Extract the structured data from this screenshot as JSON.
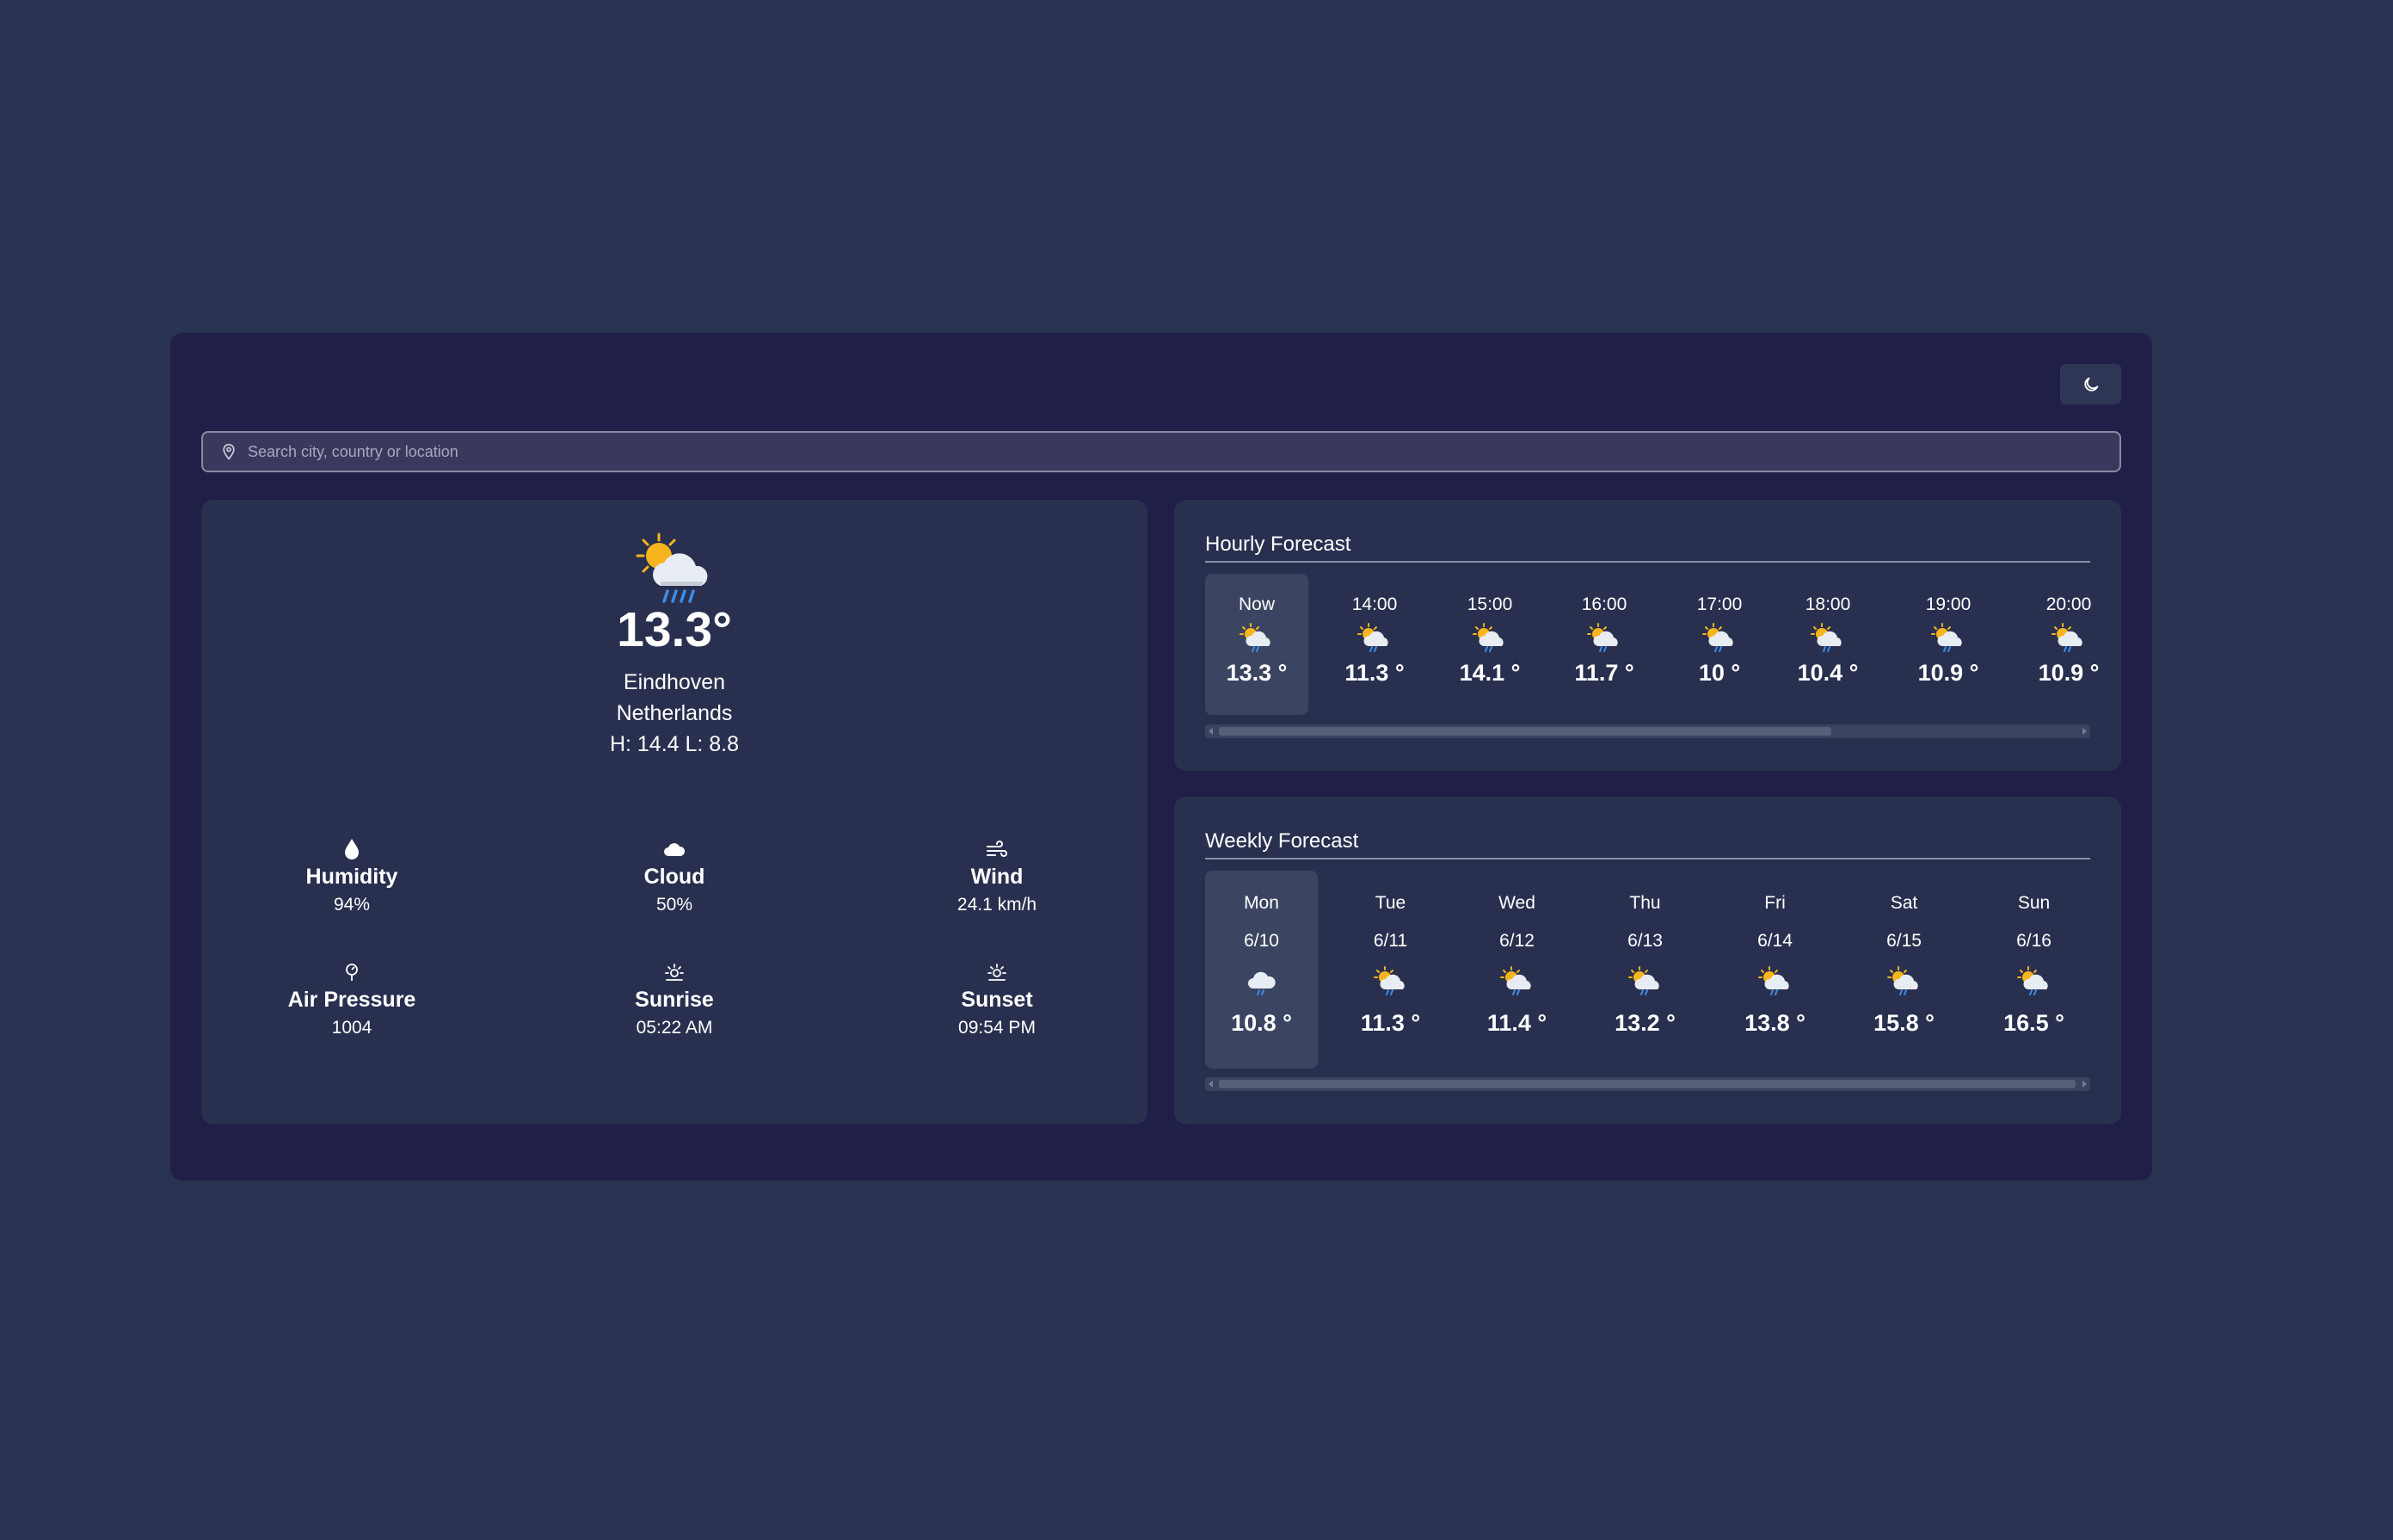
{
  "search": {
    "placeholder": "Search city, country or location"
  },
  "theme_toggle": {
    "icon": "moon-icon"
  },
  "current": {
    "icon": "partly-cloudy-rain-icon",
    "temp": "13.3°",
    "city": "Eindhoven",
    "country": "Netherlands",
    "high_low": "H: 14.4 L: 8.8",
    "stats": [
      {
        "label": "Humidity",
        "value": "94%",
        "icon": "droplet-icon"
      },
      {
        "label": "Cloud",
        "value": "50%",
        "icon": "cloud-icon"
      },
      {
        "label": "Wind",
        "value": "24.1 km/h",
        "icon": "wind-icon"
      },
      {
        "label": "Air Pressure",
        "value": "1004",
        "icon": "pressure-icon"
      },
      {
        "label": "Sunrise",
        "value": "05:22 AM",
        "icon": "sunrise-icon"
      },
      {
        "label": "Sunset",
        "value": "09:54 PM",
        "icon": "sunset-icon"
      }
    ]
  },
  "hourly": {
    "title": "Hourly Forecast",
    "items": [
      {
        "time": "Now",
        "temp": "13.3 °"
      },
      {
        "time": "14:00",
        "temp": "11.3 °"
      },
      {
        "time": "15:00",
        "temp": "14.1 °"
      },
      {
        "time": "16:00",
        "temp": "11.7 °"
      },
      {
        "time": "17:00",
        "temp": "10 °"
      },
      {
        "time": "18:00",
        "temp": "10.4 °"
      },
      {
        "time": "19:00",
        "temp": "10.9 °"
      },
      {
        "time": "20:00",
        "temp": "10.9 °"
      }
    ]
  },
  "weekly": {
    "title": "Weekly Forecast",
    "items": [
      {
        "day": "Mon",
        "date": "6/10",
        "temp": "10.8 °",
        "icon": "cloud-rain-icon"
      },
      {
        "day": "Tue",
        "date": "6/11",
        "temp": "11.3 °",
        "icon": "partly-cloudy-rain-icon"
      },
      {
        "day": "Wed",
        "date": "6/12",
        "temp": "11.4 °",
        "icon": "partly-cloudy-rain-icon"
      },
      {
        "day": "Thu",
        "date": "6/13",
        "temp": "13.2 °",
        "icon": "partly-cloudy-rain-icon"
      },
      {
        "day": "Fri",
        "date": "6/14",
        "temp": "13.8 °",
        "icon": "partly-cloudy-rain-icon"
      },
      {
        "day": "Sat",
        "date": "6/15",
        "temp": "15.8 °",
        "icon": "partly-cloudy-rain-icon"
      },
      {
        "day": "Sun",
        "date": "6/16",
        "temp": "16.5 °",
        "icon": "partly-cloudy-rain-icon"
      }
    ]
  },
  "colors": {
    "background": "#293250",
    "panel": "#1f1f47",
    "card": "#29304f",
    "sun": "#f6b51e",
    "rain": "#3c8ee8"
  }
}
